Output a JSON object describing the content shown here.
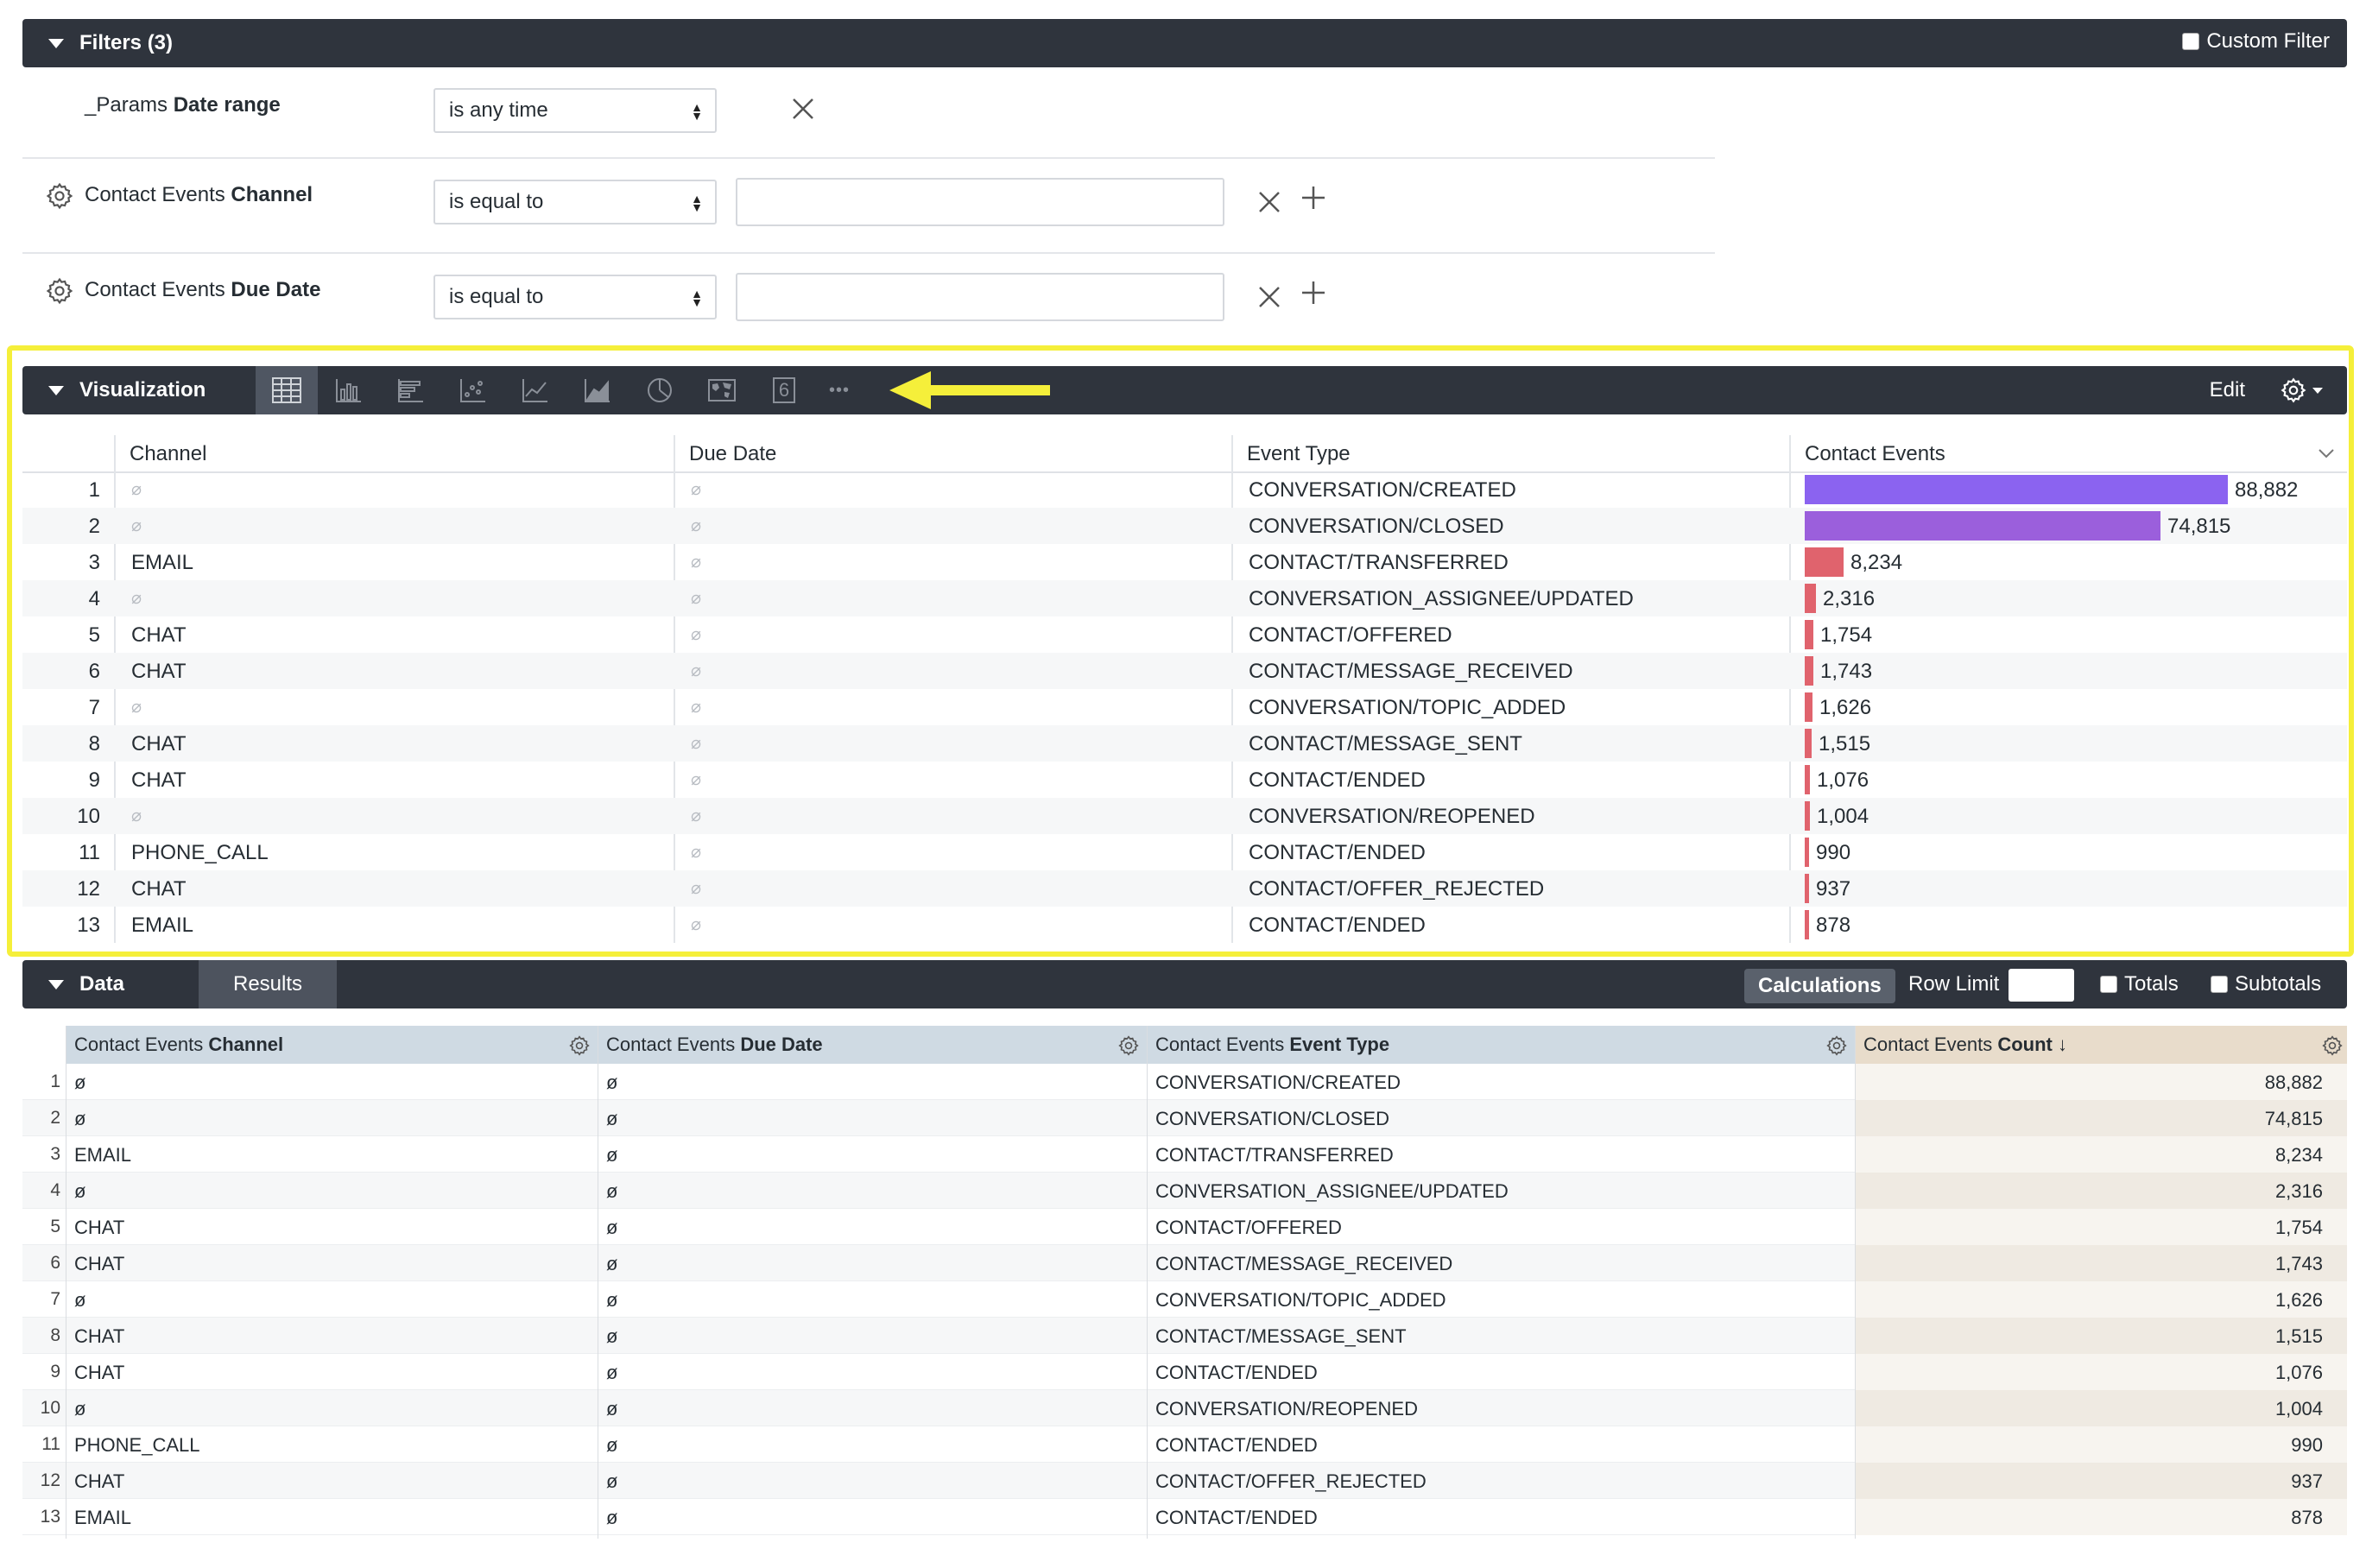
{
  "filters": {
    "title": "Filters (3)",
    "custom_filter_label": "Custom Filter",
    "rows": [
      {
        "prefix": "_Params ",
        "field": "Date range",
        "operator": "is any time"
      },
      {
        "prefix": "Contact Events ",
        "field": "Channel",
        "operator": "is equal to",
        "value": ""
      },
      {
        "prefix": "Contact Events ",
        "field": "Due Date",
        "operator": "is equal to",
        "value": ""
      }
    ]
  },
  "visualization": {
    "title": "Visualization",
    "edit_label": "Edit",
    "more_label": "•••",
    "table_viz_number": "6",
    "columns": [
      "Channel",
      "Due Date",
      "Event Type",
      "Contact Events"
    ],
    "null_symbol": "⌀",
    "bar_colors": {
      "top1": "#8b63f0",
      "top2": "#9b5fdc",
      "other": "#e0636d"
    },
    "highlight_color": "#f5ef3a"
  },
  "data_panel": {
    "title": "Data",
    "tab_results": "Results",
    "calculations_label": "Calculations",
    "row_limit_label": "Row Limit",
    "totals_label": "Totals",
    "subtotals_label": "Subtotals",
    "columns": [
      {
        "prefix": "Contact Events ",
        "name": "Channel"
      },
      {
        "prefix": "Contact Events ",
        "name": "Due Date"
      },
      {
        "prefix": "Contact Events ",
        "name": "Event Type"
      },
      {
        "prefix": "Contact Events ",
        "name": "Count ↓"
      }
    ],
    "null_symbol": "ø"
  },
  "rows": [
    {
      "n": "1",
      "channel": null,
      "due": null,
      "type": "CONVERSATION/CREATED",
      "count": 88882,
      "count_label": "88,882"
    },
    {
      "n": "2",
      "channel": null,
      "due": null,
      "type": "CONVERSATION/CLOSED",
      "count": 74815,
      "count_label": "74,815"
    },
    {
      "n": "3",
      "channel": "EMAIL",
      "due": null,
      "type": "CONTACT/TRANSFERRED",
      "count": 8234,
      "count_label": "8,234"
    },
    {
      "n": "4",
      "channel": null,
      "due": null,
      "type": "CONVERSATION_ASSIGNEE/UPDATED",
      "count": 2316,
      "count_label": "2,316"
    },
    {
      "n": "5",
      "channel": "CHAT",
      "due": null,
      "type": "CONTACT/OFFERED",
      "count": 1754,
      "count_label": "1,754"
    },
    {
      "n": "6",
      "channel": "CHAT",
      "due": null,
      "type": "CONTACT/MESSAGE_RECEIVED",
      "count": 1743,
      "count_label": "1,743"
    },
    {
      "n": "7",
      "channel": null,
      "due": null,
      "type": "CONVERSATION/TOPIC_ADDED",
      "count": 1626,
      "count_label": "1,626"
    },
    {
      "n": "8",
      "channel": "CHAT",
      "due": null,
      "type": "CONTACT/MESSAGE_SENT",
      "count": 1515,
      "count_label": "1,515"
    },
    {
      "n": "9",
      "channel": "CHAT",
      "due": null,
      "type": "CONTACT/ENDED",
      "count": 1076,
      "count_label": "1,076"
    },
    {
      "n": "10",
      "channel": null,
      "due": null,
      "type": "CONVERSATION/REOPENED",
      "count": 1004,
      "count_label": "1,004"
    },
    {
      "n": "11",
      "channel": "PHONE_CALL",
      "due": null,
      "type": "CONTACT/ENDED",
      "count": 990,
      "count_label": "990"
    },
    {
      "n": "12",
      "channel": "CHAT",
      "due": null,
      "type": "CONTACT/OFFER_REJECTED",
      "count": 937,
      "count_label": "937"
    },
    {
      "n": "13",
      "channel": "EMAIL",
      "due": null,
      "type": "CONTACT/ENDED",
      "count": 878,
      "count_label": "878"
    }
  ]
}
